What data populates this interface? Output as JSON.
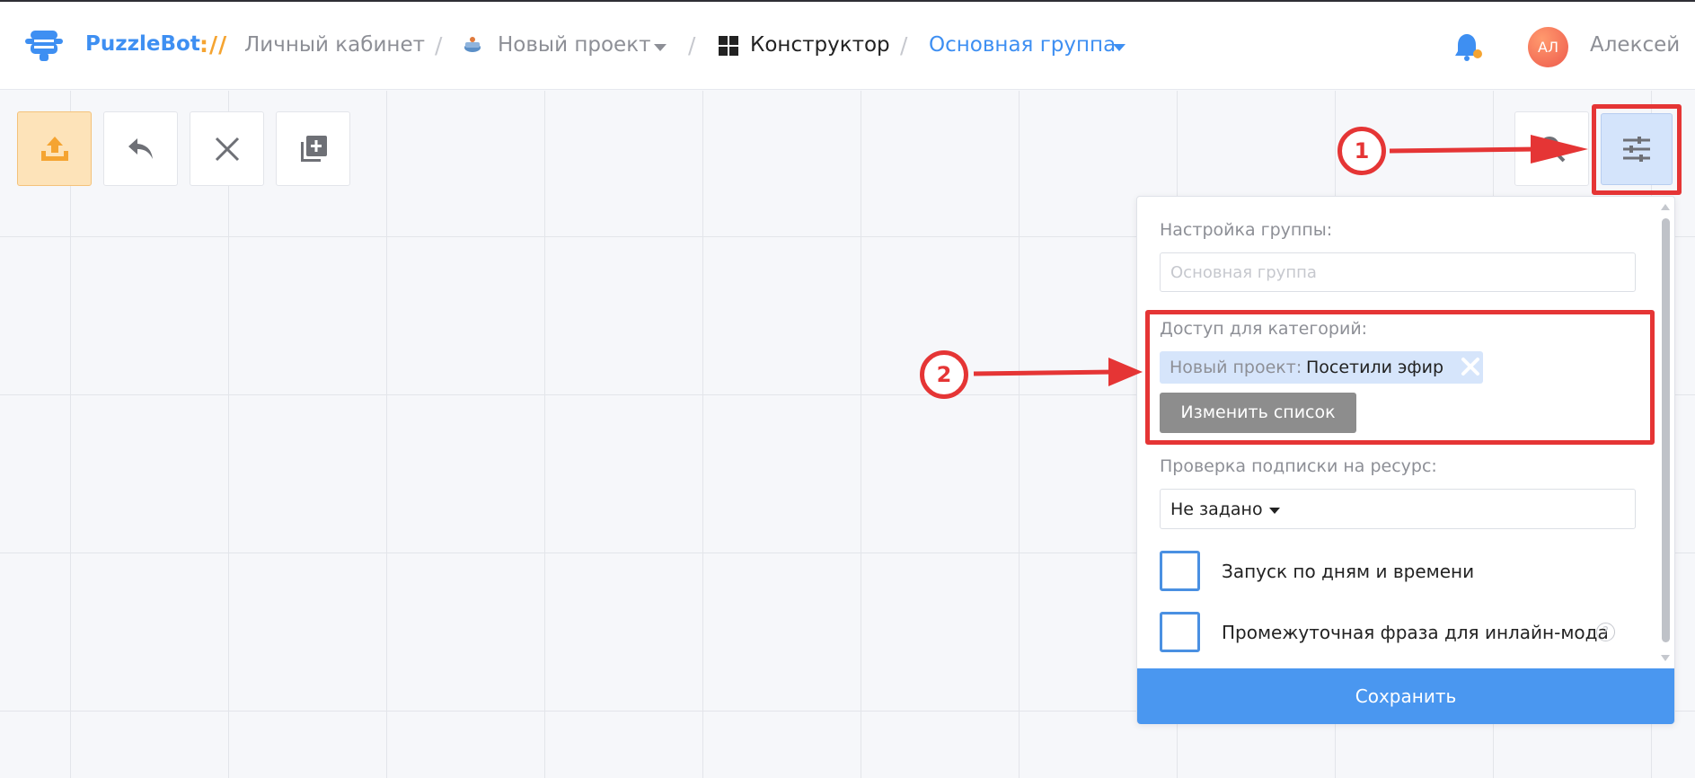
{
  "header": {
    "brand": "PuzzleBot",
    "brand_sep": "://",
    "breadcrumbs": {
      "cabinet": "Личный кабинет",
      "project": "Новый проект",
      "constructor": "Конструктор",
      "group": "Основная группа"
    },
    "avatar_initials": "АЛ",
    "username": "Алексей"
  },
  "toolbar": {
    "icons": [
      "upload-icon",
      "undo-icon",
      "close-icon",
      "add-copy-icon"
    ],
    "right_icons": [
      "search-icon",
      "sliders-icon"
    ]
  },
  "panel": {
    "group_settings_label": "Настройка группы:",
    "group_name_placeholder": "Основная группа",
    "category_access_label": "Доступ для категорий:",
    "tag_prefix": "Новый проект:",
    "tag_value": "Посетили эфир",
    "change_list_button": "Изменить список",
    "subscription_check_label": "Проверка подписки на ресурс:",
    "subscription_select_value": "Не задано",
    "checkbox_schedule": "Запуск по дням и времени",
    "checkbox_inline": "Промежуточная фраза для инлайн-мода",
    "help_glyph": "?",
    "save_button": "Сохранить"
  },
  "annotations": {
    "marker_1": "1",
    "marker_2": "2"
  },
  "colors": {
    "accent_blue": "#3e8ff2",
    "brand_orange": "#f5a431",
    "annotation_red": "#e53535",
    "save_blue": "#4a97f0"
  }
}
